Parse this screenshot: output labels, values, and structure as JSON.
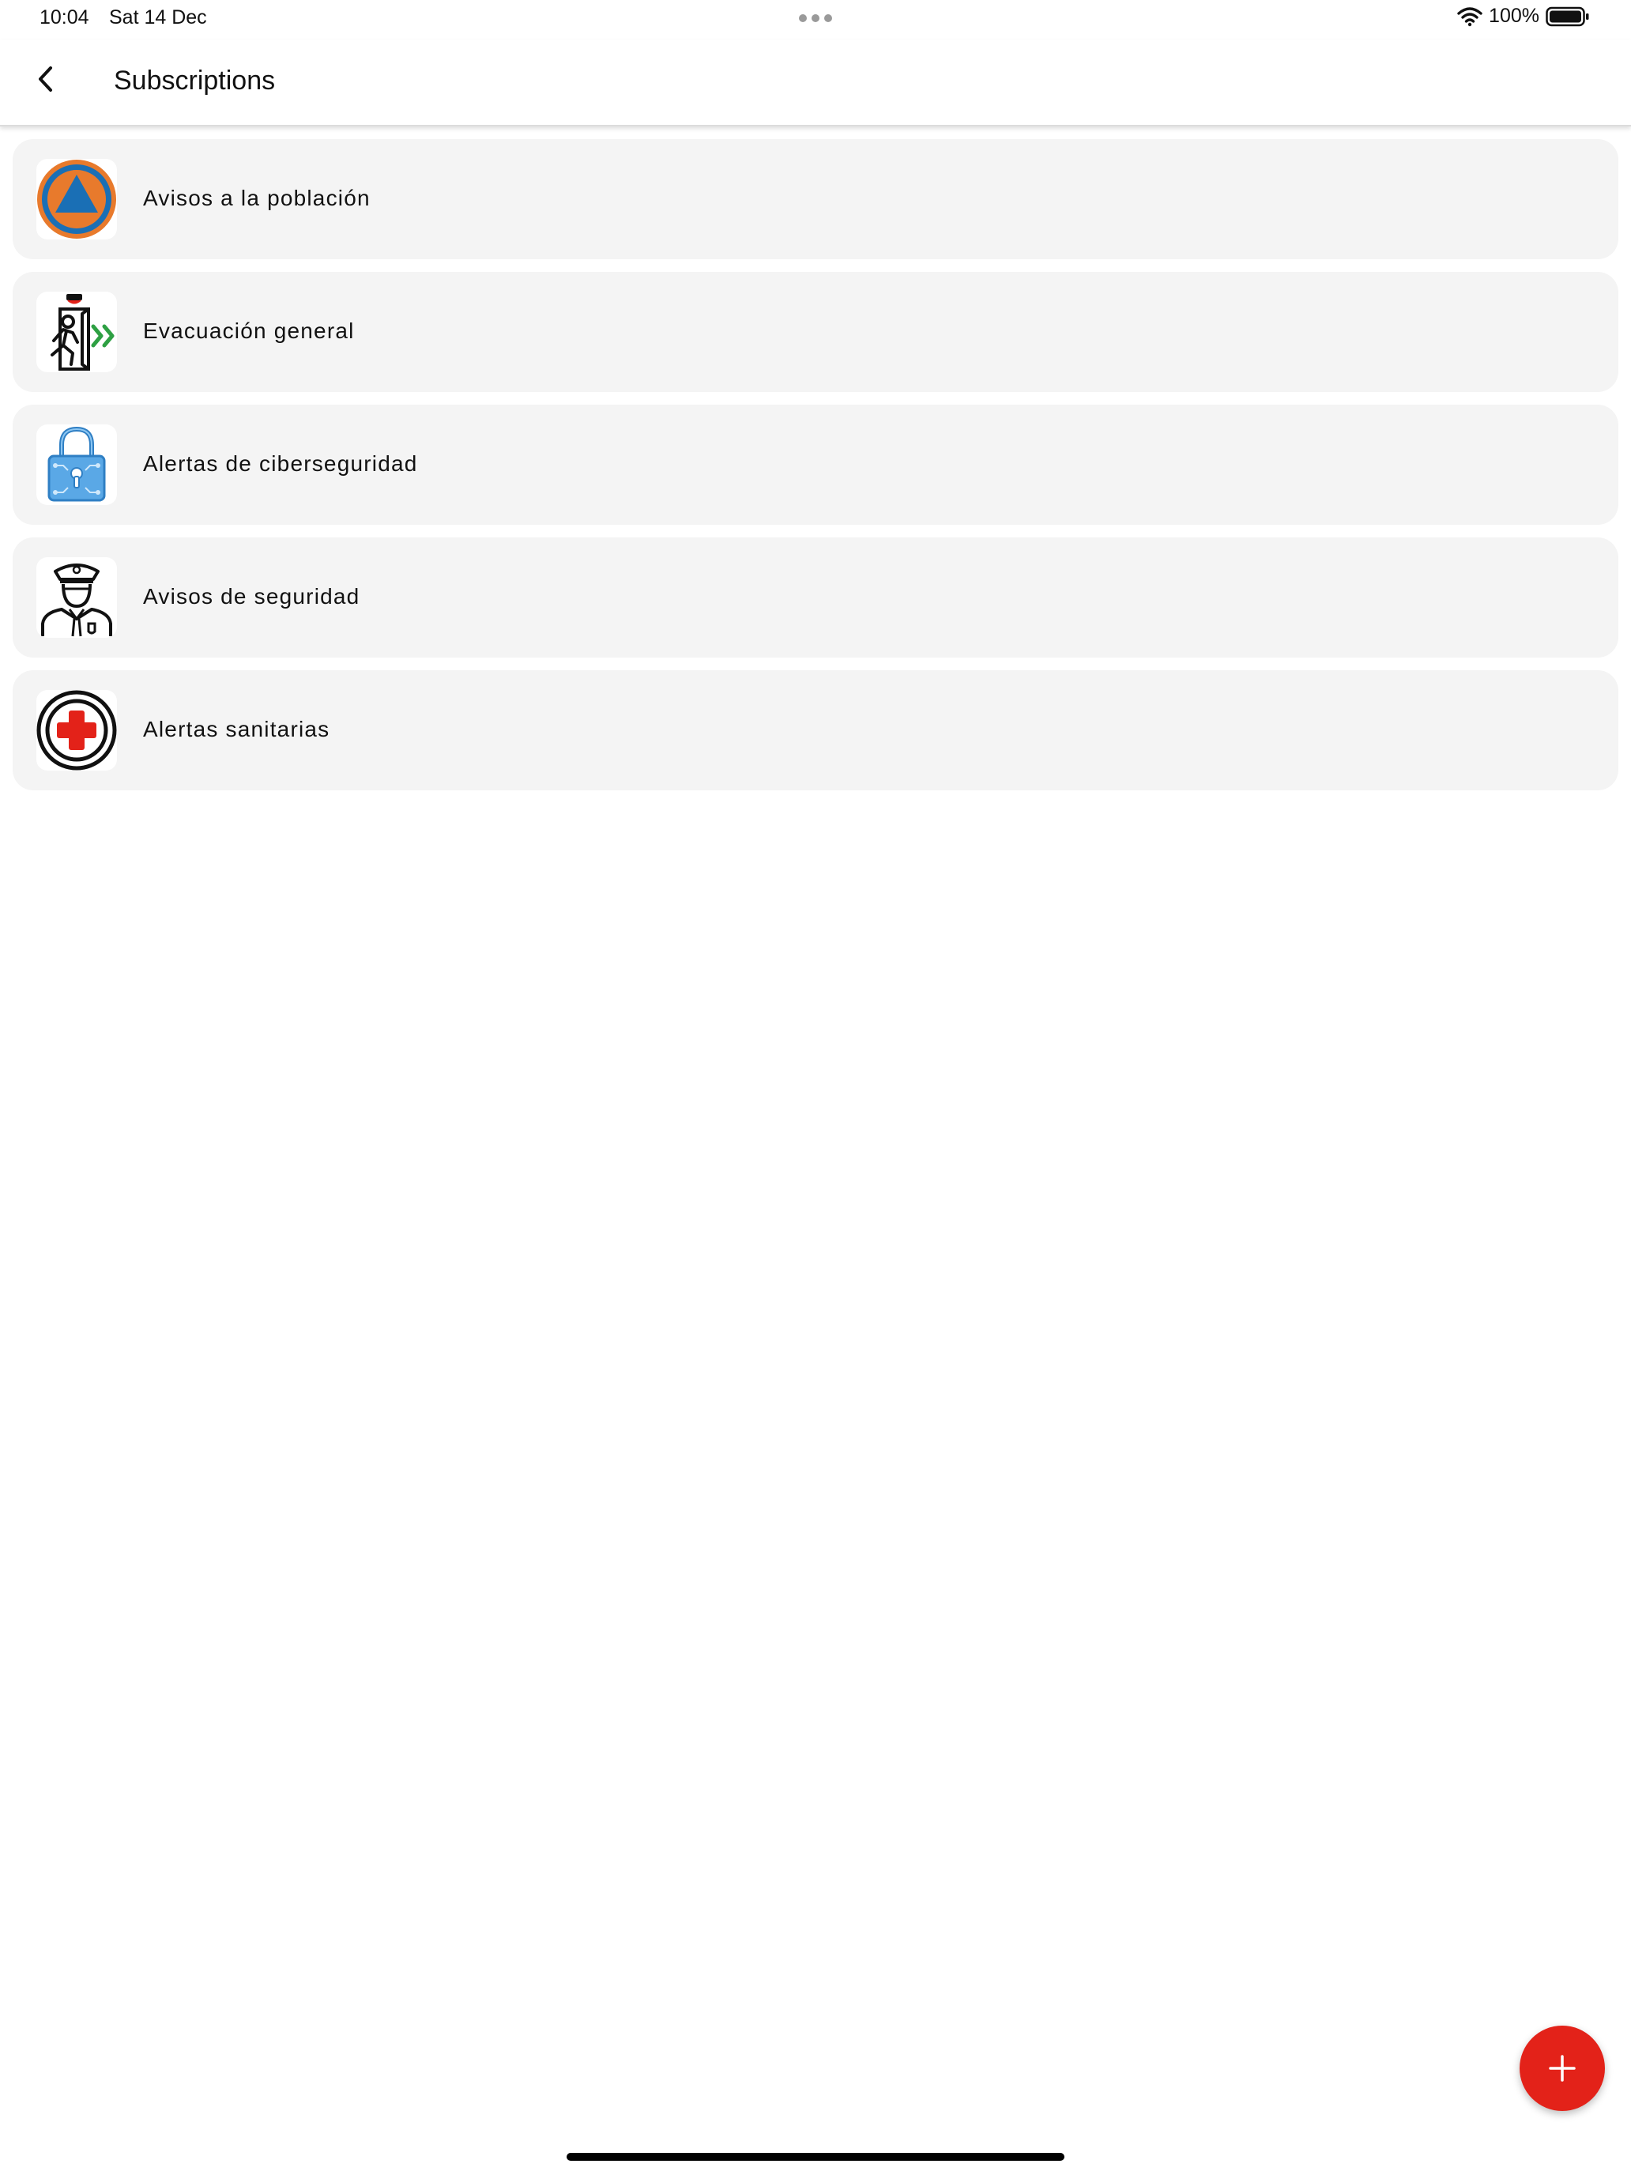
{
  "status_bar": {
    "time": "10:04",
    "date": "Sat 14 Dec",
    "battery": "100%"
  },
  "app_bar": {
    "title": "Subscriptions"
  },
  "subscriptions": [
    {
      "label": "Avisos a la población",
      "icon": "civil-protection-icon"
    },
    {
      "label": "Evacuación general",
      "icon": "evacuation-exit-icon"
    },
    {
      "label": "Alertas de ciberseguridad",
      "icon": "cyber-lock-icon"
    },
    {
      "label": "Avisos de seguridad",
      "icon": "police-officer-icon"
    },
    {
      "label": "Alertas sanitarias",
      "icon": "red-cross-icon"
    }
  ],
  "colors": {
    "accent": "#e32219",
    "card_background": "#f4f4f4",
    "civil_protection_blue": "#1a6fb5",
    "civil_protection_orange": "#e87a2c",
    "evacuation_green": "#2ea043",
    "cyber_blue": "#5aa8e6"
  },
  "fab": {
    "icon": "plus-icon"
  }
}
